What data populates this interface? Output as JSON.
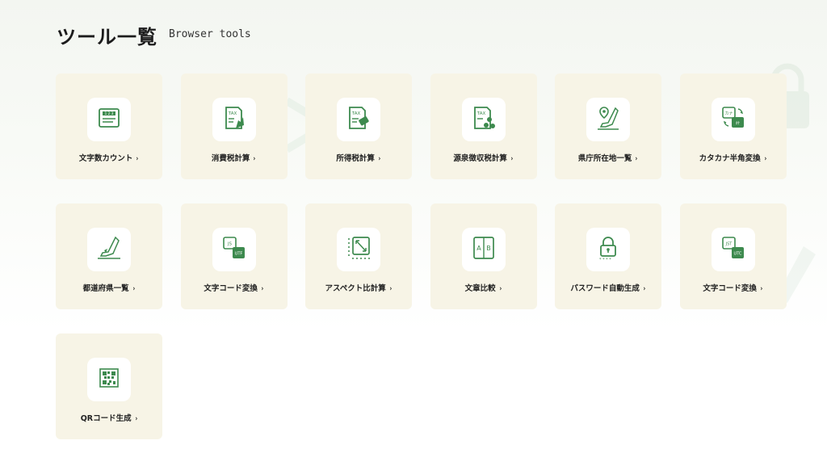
{
  "header": {
    "title": "ツール一覧",
    "subtitle": "Browser tools"
  },
  "chevron": "›",
  "colors": {
    "card_bg": "#f7f4e6",
    "icon_green": "#3d8a4e",
    "icon_dark": "#2f6b3e"
  },
  "tools": [
    {
      "label": "文字数カウント",
      "icon": "char-count-icon"
    },
    {
      "label": "消費税計算",
      "icon": "consumption-tax-icon"
    },
    {
      "label": "所得税計算",
      "icon": "income-tax-icon"
    },
    {
      "label": "源泉徴収税計算",
      "icon": "withholding-tax-icon"
    },
    {
      "label": "県庁所在地一覧",
      "icon": "prefectural-capital-map-icon"
    },
    {
      "label": "カタカナ半角変換",
      "icon": "katakana-convert-icon"
    },
    {
      "label": "都道府県一覧",
      "icon": "prefecture-map-icon"
    },
    {
      "label": "文字コード変換",
      "icon": "js-utf-convert-icon"
    },
    {
      "label": "アスペクト比計算",
      "icon": "aspect-ratio-icon"
    },
    {
      "label": "文章比較",
      "icon": "text-compare-icon"
    },
    {
      "label": "パスワード自動生成",
      "icon": "padlock-icon"
    },
    {
      "label": "文字コード変換",
      "icon": "jst-utc-convert-icon"
    },
    {
      "label": "QRコード生成",
      "icon": "qr-code-icon"
    }
  ]
}
